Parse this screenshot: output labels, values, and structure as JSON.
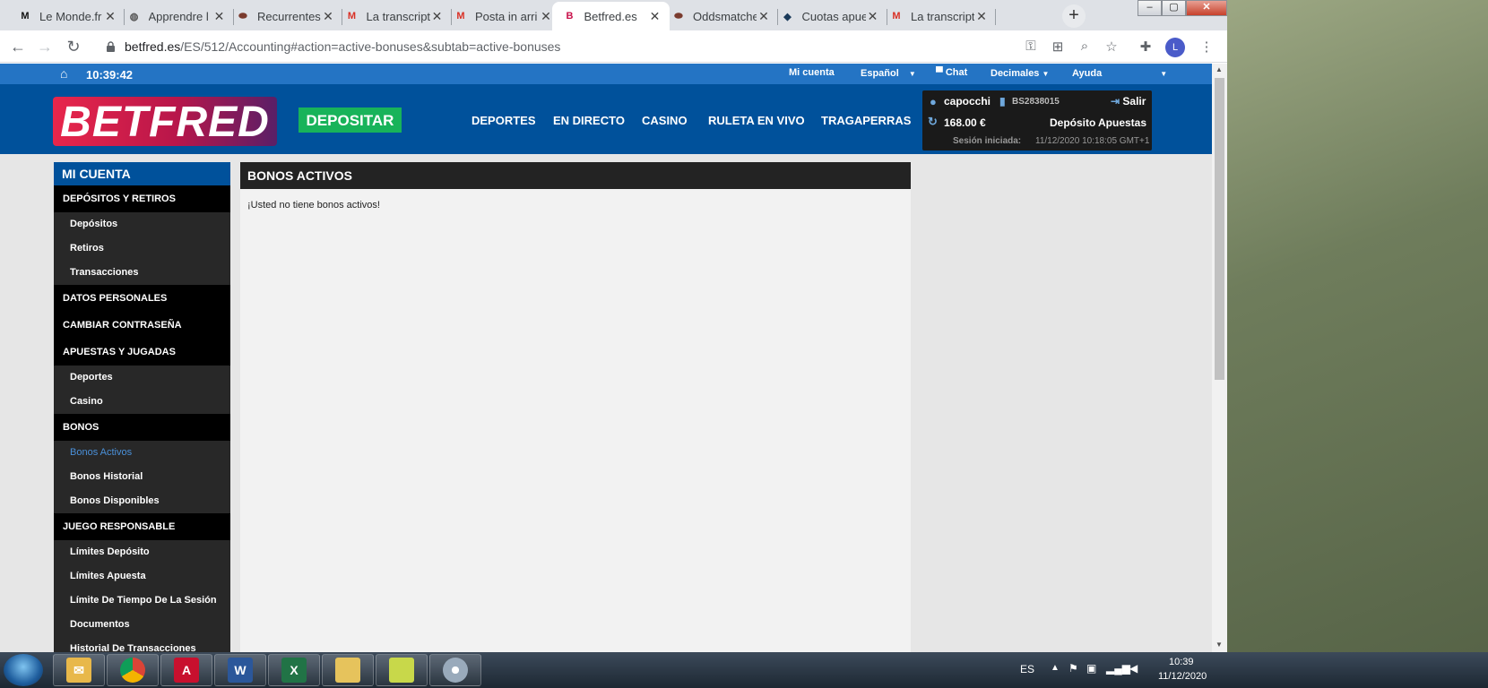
{
  "browser": {
    "tabs": [
      {
        "title": "Le Monde.fr",
        "favicon": "lemonde-icon",
        "active": false
      },
      {
        "title": "Apprendre l",
        "favicon": "globe-icon",
        "active": false
      },
      {
        "title": "Recurrentes",
        "favicon": "ball-icon",
        "active": false
      },
      {
        "title": "La transcript",
        "favicon": "gmail-icon",
        "active": false
      },
      {
        "title": "Posta in arri",
        "favicon": "gmail-icon",
        "active": false
      },
      {
        "title": "Betfred.es",
        "favicon": "betfred-icon",
        "active": true
      },
      {
        "title": "Oddsmatche",
        "favicon": "ball-icon",
        "active": false
      },
      {
        "title": "Cuotas apue",
        "favicon": "cuotas-icon",
        "active": false
      },
      {
        "title": "La transcript",
        "favicon": "gmail-icon",
        "active": false
      }
    ],
    "url_host": "betfred.es",
    "url_path": "/ES/512/Accounting#action=active-bonuses&subtab=active-bonuses",
    "profile_initial": "L"
  },
  "site": {
    "topbar": {
      "time": "10:39:42",
      "mi_cuenta": "Mi cuenta",
      "language": "Español",
      "chat": "Chat",
      "odds_format": "Decimales",
      "help": "Ayuda"
    },
    "logo_text": "BETFRED",
    "deposit_button": "DEPOSITAR",
    "nav": [
      "DEPORTES",
      "EN DIRECTO",
      "CASINO",
      "RULETA EN VIVO",
      "TRAGAPERRAS"
    ],
    "account": {
      "username": "capocchi",
      "account_id": "BS2838015",
      "logout": "Salir",
      "balance": "168.00 €",
      "deposit_link": "Depósito",
      "bets_link": "Apuestas",
      "session_label": "Sesión iniciada:",
      "session_time": "11/12/2020 10:18:05 GMT+1"
    }
  },
  "sidebar": {
    "title": "MI CUENTA",
    "sections": [
      {
        "label": "DEPÓSITOS Y RETIROS",
        "items": [
          "Depósitos",
          "Retiros",
          "Transacciones"
        ]
      },
      {
        "label": "DATOS PERSONALES",
        "items": []
      },
      {
        "label": "CAMBIAR CONTRASEÑA",
        "items": []
      },
      {
        "label": "APUESTAS Y JUGADAS",
        "items": [
          "Deportes",
          "Casino"
        ]
      },
      {
        "label": "BONOS",
        "items": [
          "Bonos Activos",
          "Bonos Historial",
          "Bonos Disponibles"
        ]
      },
      {
        "label": "JUEGO RESPONSABLE",
        "items": [
          "Límites Depósito",
          "Límites Apuesta",
          "Límite De Tiempo De La Sesión",
          "Documentos",
          "Historial De Transacciones"
        ]
      }
    ],
    "active_item": "Bonos Activos"
  },
  "content": {
    "title": "BONOS ACTIVOS",
    "message": "¡Usted no tiene bonos activos!"
  },
  "taskbar": {
    "language": "ES",
    "time": "10:39",
    "date": "11/12/2020"
  },
  "colors": {
    "brand_blue": "#00519b",
    "topbar_blue": "#2474c4",
    "deposit_green": "#18b35a",
    "active_link": "#4a90d9"
  }
}
